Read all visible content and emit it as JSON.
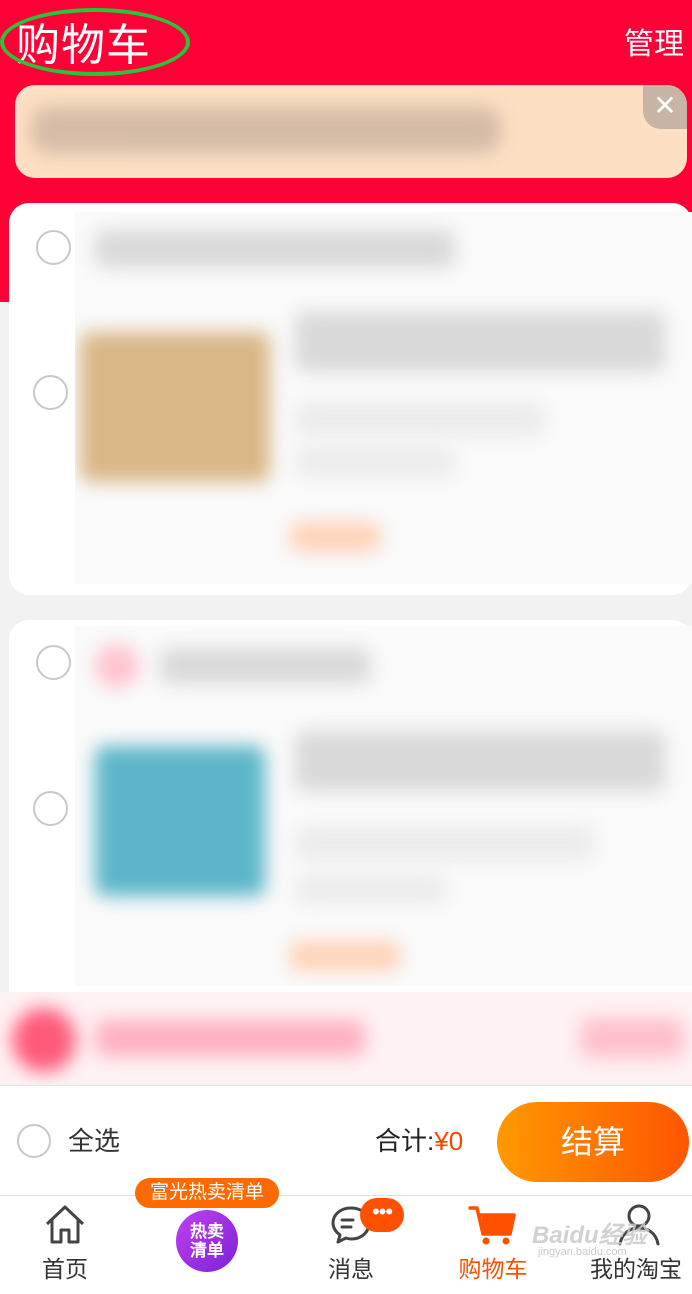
{
  "header": {
    "title": "购物车",
    "manage_label": "管理"
  },
  "notice": {
    "close_glyph": "✕"
  },
  "footer": {
    "select_all_label": "全选",
    "total_label": "合计:",
    "total_value": "¥0",
    "checkout_label": "结算"
  },
  "tabs": [
    {
      "label": "首页",
      "icon": "home-icon",
      "active": false
    },
    {
      "label": "",
      "icon": "hot-list-icon",
      "active": false
    },
    {
      "label": "消息",
      "icon": "message-icon",
      "active": false
    },
    {
      "label": "购物车",
      "icon": "cart-icon",
      "active": true
    },
    {
      "label": "我的淘宝",
      "icon": "user-icon",
      "active": false
    }
  ],
  "hot_list": {
    "banner": "富光热卖清单",
    "circle_line1": "热卖",
    "circle_line2": "清单"
  },
  "message_badge": "•••",
  "watermark": {
    "brand": "Baidu经验",
    "url": "jingyan.baidu.com"
  },
  "colors": {
    "brand_red": "#ff0036",
    "accent_orange": "#ff5000",
    "active_tab": "#ff5000",
    "highlight_ring": "#29c43a"
  }
}
